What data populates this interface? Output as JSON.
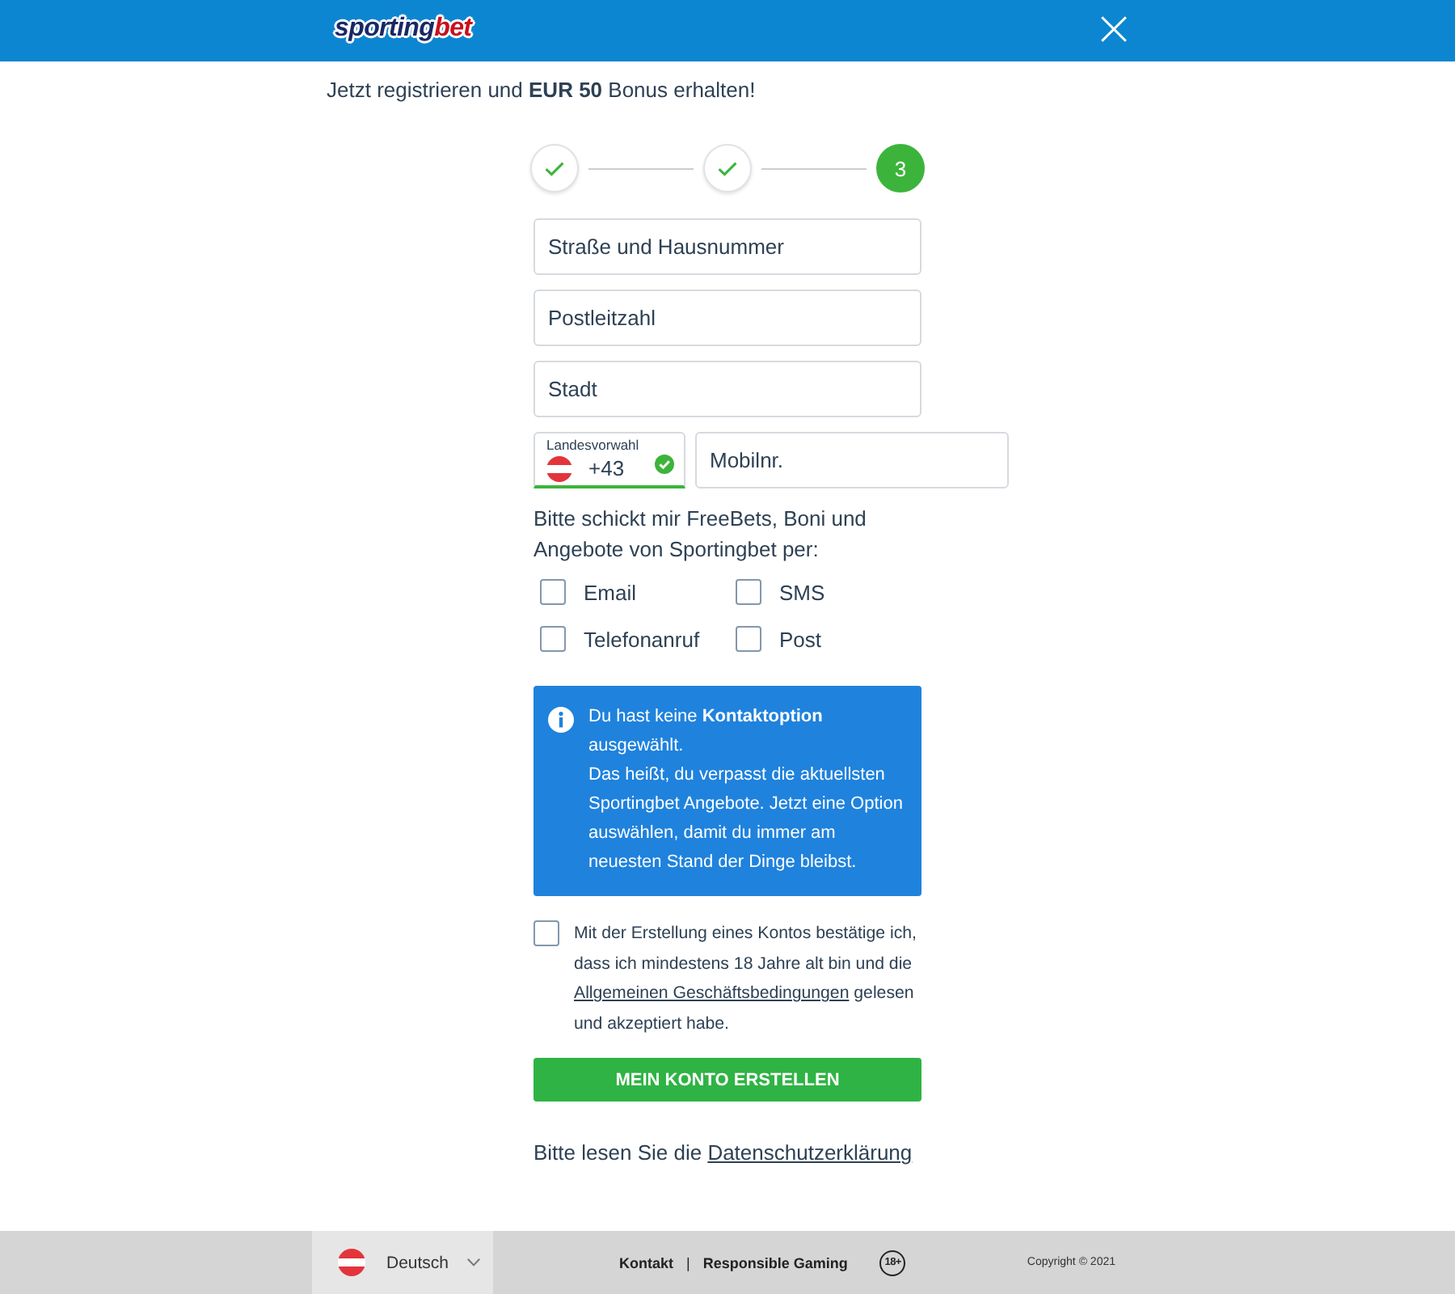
{
  "header": {
    "logo": {
      "main": "sporting",
      "accent": "bet"
    }
  },
  "promo": "Jetzt registrieren und **EUR 50** Bonus erhalten!",
  "steps": [
    {
      "completed": true,
      "selected": false
    },
    {
      "completed": true,
      "selected": false
    },
    {
      "label": "3",
      "completed": false,
      "selected": true
    }
  ],
  "address_fields": [
    {
      "placeholder": "Straße und Hausnummer"
    },
    {
      "placeholder": "Postleitzahl"
    },
    {
      "placeholder": "Stadt"
    }
  ],
  "phone": {
    "country_code": {
      "label": "Landesvorwahl",
      "value": "+43",
      "valid": true
    },
    "number": {
      "placeholder": "Mobilnr."
    }
  },
  "contact_prompt": "Bitte schickt mir FreeBets, Boni und Angebote von Sportingbet per:",
  "contact_options": [
    {
      "label": "Email",
      "checked": false
    },
    {
      "label": "SMS",
      "checked": false
    },
    {
      "label": "Telefonanruf",
      "checked": false
    },
    {
      "label": "Post",
      "checked": false
    }
  ],
  "info_box": {
    "paragraphs": [
      "Du hast keine **Kontaktoption** ausgewählt.",
      "Das heißt, du verpasst die aktuellsten Sportingbet Angebote. Jetzt eine Option auswählen, damit du immer am neuesten Stand der Dinge bleibst."
    ]
  },
  "terms": {
    "checked": false,
    "text_before": "Mit der Erstellung eines Kontos bestätige ich, dass ich mindestens 18 Jahre alt bin und die",
    "link": "Allgemeinen Geschäftsbedingungen",
    "text_after": "gelesen und akzeptiert habe."
  },
  "submit_button": "MEIN KONTO ERSTELLEN",
  "privacy": {
    "text": "Bitte lesen Sie die",
    "link": "Datenschutzerklärung"
  },
  "footer": {
    "language": "Deutsch",
    "links": [
      "Kontakt",
      "Responsible Gaming"
    ],
    "separator": "|",
    "age_badge": "18+",
    "copyright": "Copyright © 2021"
  }
}
